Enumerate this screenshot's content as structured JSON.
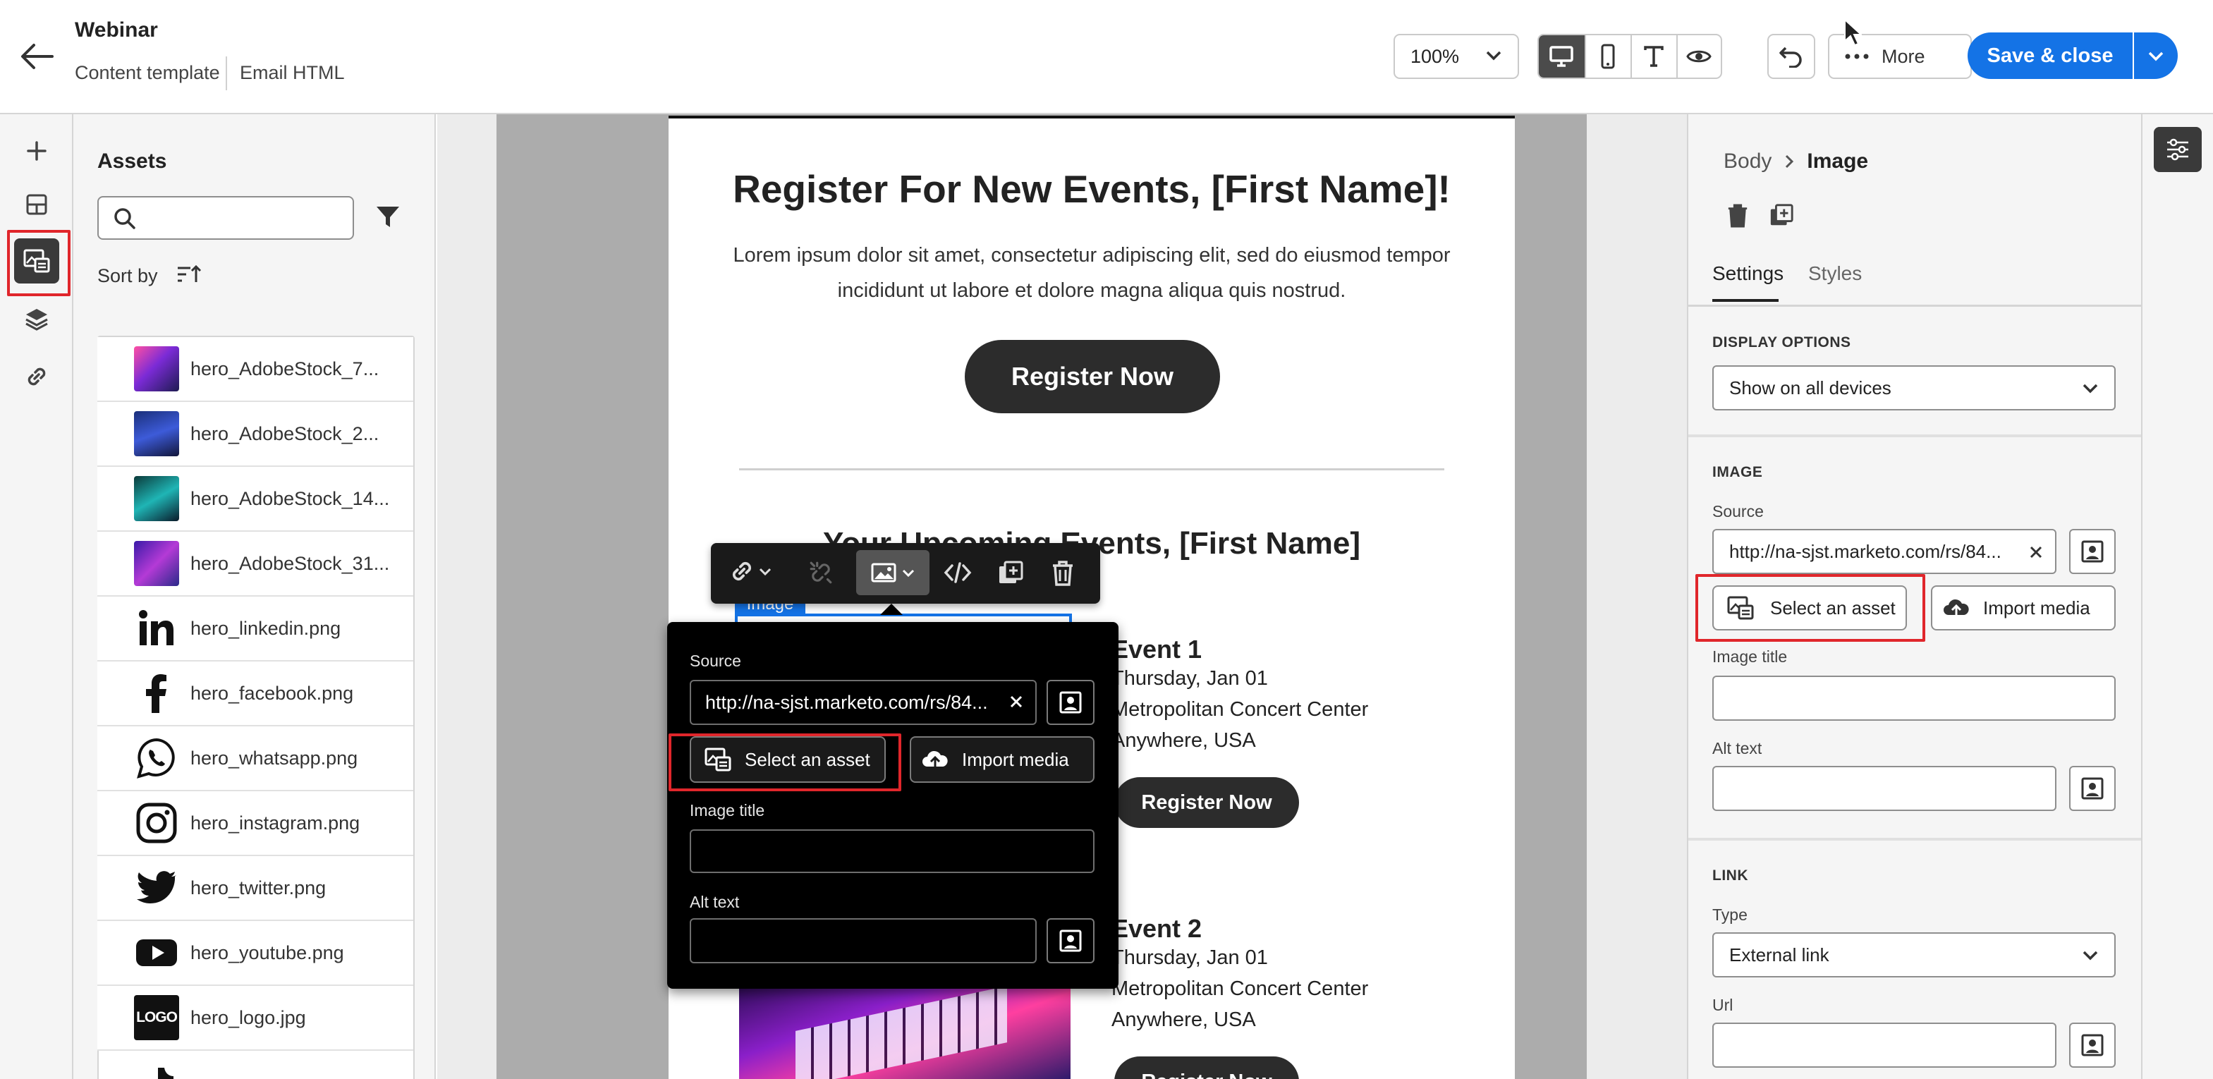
{
  "header": {
    "title": "Webinar",
    "breadcrumb": [
      "Content template",
      "Email HTML"
    ],
    "zoom": "100%",
    "more_label": "More",
    "save_label": "Save & close"
  },
  "assets": {
    "title": "Assets",
    "search_placeholder": "",
    "sort_label": "Sort by",
    "items": [
      {
        "name": "hero_AdobeStock_7...",
        "icon": "concert-photo"
      },
      {
        "name": "hero_AdobeStock_2...",
        "icon": "concert-photo"
      },
      {
        "name": "hero_AdobeStock_14...",
        "icon": "concert-photo"
      },
      {
        "name": "hero_AdobeStock_31...",
        "icon": "concert-photo"
      },
      {
        "name": "hero_linkedin.png",
        "icon": "linkedin-icon"
      },
      {
        "name": "hero_facebook.png",
        "icon": "facebook-icon"
      },
      {
        "name": "hero_whatsapp.png",
        "icon": "whatsapp-icon"
      },
      {
        "name": "hero_instagram.png",
        "icon": "instagram-icon"
      },
      {
        "name": "hero_twitter.png",
        "icon": "twitter-icon"
      },
      {
        "name": "hero_youtube.png",
        "icon": "youtube-icon"
      },
      {
        "name": "hero_logo.jpg",
        "icon": "logo-icon"
      }
    ]
  },
  "email": {
    "heading": "Register For New Events, [First Name]!",
    "intro_line1": "Lorem ipsum dolor sit amet, consectetur adipiscing elit, sed do eiusmod tempor",
    "intro_line2": "incididunt ut labore et dolore magna aliqua quis nostrud.",
    "register_label": "Register Now",
    "upcoming_heading": "Your Upcoming Events, [First Name]",
    "image_tag": "Image",
    "events": [
      {
        "title": "Event 1",
        "date": "Thursday, Jan 01",
        "venue": "Metropolitan Concert Center",
        "location": "Anywhere, USA",
        "button": "Register Now"
      },
      {
        "title": "Event 2",
        "date": "Thursday, Jan 01",
        "venue": "Metropolitan Concert Center",
        "location": "Anywhere, USA",
        "button": "Register Now"
      }
    ]
  },
  "popover": {
    "source_label": "Source",
    "source_value": "http://na-sjst.marketo.com/rs/84...",
    "select_asset_label": "Select an asset",
    "import_media_label": "Import media",
    "image_title_label": "Image title",
    "alt_text_label": "Alt text"
  },
  "properties": {
    "breadcrumb_parent": "Body",
    "breadcrumb_current": "Image",
    "tabs": [
      "Settings",
      "Styles"
    ],
    "display_options_heading": "DISPLAY OPTIONS",
    "display_options_value": "Show on all devices",
    "image_heading": "IMAGE",
    "source_label": "Source",
    "source_value": "http://na-sjst.marketo.com/rs/84...",
    "select_asset_label": "Select an asset",
    "import_media_label": "Import media",
    "image_title_label": "Image title",
    "alt_text_label": "Alt text",
    "link_heading": "LINK",
    "type_label": "Type",
    "type_value": "External link",
    "url_label": "Url"
  },
  "colors": {
    "accent": "#1473e6",
    "highlight": "#e0262b"
  }
}
